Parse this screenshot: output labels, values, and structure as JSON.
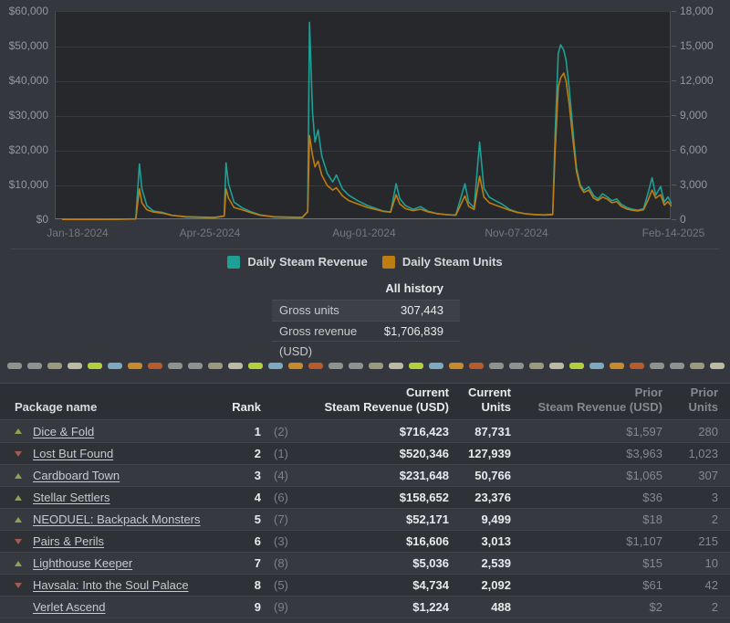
{
  "chart_data": {
    "type": "line",
    "grid": true,
    "legend_position": "bottom",
    "x_ticklabels": [
      "Jan-18-2024",
      "Apr-25-2024",
      "Aug-01-2024",
      "Nov-07-2024",
      "Feb-14-2025"
    ],
    "y_left": {
      "range": [
        0,
        60000
      ],
      "ticklabels": [
        "$60,000",
        "$50,000",
        "$40,000",
        "$30,000",
        "$20,000",
        "$10,000",
        "$0"
      ]
    },
    "y_right": {
      "range": [
        0,
        18000
      ],
      "ticklabels": [
        "18,000",
        "15,000",
        "12,000",
        "9,000",
        "6,000",
        "3,000",
        "0"
      ]
    },
    "x_frac": [
      0,
      0.02,
      0.05,
      0.096,
      0.121,
      0.127,
      0.131,
      0.139,
      0.15,
      0.165,
      0.18,
      0.203,
      0.226,
      0.249,
      0.266,
      0.269,
      0.273,
      0.282,
      0.295,
      0.31,
      0.325,
      0.348,
      0.371,
      0.394,
      0.403,
      0.406,
      0.411,
      0.415,
      0.42,
      0.426,
      0.435,
      0.444,
      0.45,
      0.46,
      0.47,
      0.485,
      0.501,
      0.516,
      0.527,
      0.539,
      0.548,
      0.554,
      0.563,
      0.576,
      0.588,
      0.6,
      0.615,
      0.631,
      0.646,
      0.661,
      0.667,
      0.676,
      0.685,
      0.692,
      0.701,
      0.711,
      0.722,
      0.734,
      0.747,
      0.76,
      0.776,
      0.791,
      0.805,
      0.809,
      0.814,
      0.818,
      0.823,
      0.827,
      0.832,
      0.838,
      0.844,
      0.85,
      0.856,
      0.864,
      0.872,
      0.879,
      0.887,
      0.895,
      0.902,
      0.91,
      0.917,
      0.927,
      0.936,
      0.945,
      0.954,
      0.962,
      0.968,
      0.974,
      0.982,
      0.988,
      0.994,
      1.0
    ],
    "series": [
      {
        "name": "Daily Steam Revenue",
        "axis": "left",
        "color": "#1fa096",
        "values": [
          150,
          200,
          250,
          300,
          400,
          16200,
          9000,
          4200,
          2600,
          2200,
          1400,
          900,
          800,
          700,
          1200,
          16500,
          10500,
          5200,
          3600,
          2400,
          1500,
          900,
          800,
          750,
          2500,
          57000,
          31000,
          22500,
          26000,
          18500,
          13500,
          11000,
          13000,
          9000,
          7200,
          5600,
          4200,
          3300,
          2600,
          2300,
          10500,
          6200,
          4200,
          3100,
          3900,
          2600,
          1900,
          1600,
          1450,
          10500,
          5200,
          3600,
          22500,
          9200,
          6600,
          5600,
          4600,
          3100,
          2300,
          1850,
          1550,
          1450,
          1550,
          25000,
          48000,
          50500,
          49000,
          46000,
          38000,
          26000,
          15000,
          10200,
          8600,
          9600,
          7100,
          6100,
          7600,
          6600,
          5600,
          6100,
          4600,
          3600,
          3100,
          2900,
          3300,
          8200,
          12200,
          7200,
          9700,
          5200,
          6700,
          4700
        ]
      },
      {
        "name": "Daily Steam Units",
        "axis": "right",
        "color": "#bf7d11",
        "values": [
          40,
          50,
          60,
          80,
          100,
          2700,
          1500,
          900,
          700,
          600,
          420,
          300,
          260,
          230,
          350,
          2700,
          1900,
          1100,
          900,
          650,
          430,
          290,
          260,
          240,
          700,
          7300,
          5600,
          4600,
          5100,
          3900,
          3000,
          2600,
          2800,
          2100,
          1700,
          1400,
          1100,
          900,
          760,
          700,
          2200,
          1400,
          1000,
          820,
          950,
          720,
          560,
          470,
          430,
          2100,
          1200,
          920,
          3800,
          2000,
          1500,
          1300,
          1100,
          860,
          660,
          560,
          490,
          460,
          510,
          6000,
          11500,
          12300,
          12700,
          12000,
          10000,
          7000,
          4200,
          2900,
          2400,
          2600,
          1900,
          1700,
          2000,
          1800,
          1500,
          1600,
          1200,
          950,
          850,
          800,
          900,
          1800,
          2600,
          1900,
          2200,
          1300,
          1600,
          1200
        ]
      }
    ]
  },
  "summary": {
    "column_header": "All history",
    "rows": [
      {
        "label": "Gross units",
        "value": "307,443"
      },
      {
        "label": "Gross revenue (USD)",
        "value": "$1,706,839"
      }
    ]
  },
  "separator_colors": [
    "#8e938e",
    "#8e938e",
    "#9b997e",
    "#bcbaa0",
    "#b5cf3a",
    "#7fa9c2",
    "#c88a2d",
    "#b65c2c"
  ],
  "separator_dash_count": 36,
  "table": {
    "headers": {
      "package": "Package name",
      "rank": "Rank",
      "current_revenue": [
        "Current",
        "Steam Revenue (USD)"
      ],
      "current_units": [
        "Current",
        "Units"
      ],
      "prior_revenue": [
        "Prior",
        "Steam Revenue (USD)"
      ],
      "prior_units": [
        "Prior",
        "Units"
      ]
    },
    "rows": [
      {
        "trend": "up",
        "name": "Dice & Fold",
        "rank": "1",
        "prior_rank": "(2)",
        "cur_rev": "$716,423",
        "cur_units": "87,731",
        "prior_rev": "$1,597",
        "prior_units": "280"
      },
      {
        "trend": "down",
        "name": "Lost But Found",
        "rank": "2",
        "prior_rank": "(1)",
        "cur_rev": "$520,346",
        "cur_units": "127,939",
        "prior_rev": "$3,963",
        "prior_units": "1,023"
      },
      {
        "trend": "up",
        "name": "Cardboard Town",
        "rank": "3",
        "prior_rank": "(4)",
        "cur_rev": "$231,648",
        "cur_units": "50,766",
        "prior_rev": "$1,065",
        "prior_units": "307"
      },
      {
        "trend": "up",
        "name": "Stellar Settlers",
        "rank": "4",
        "prior_rank": "(6)",
        "cur_rev": "$158,652",
        "cur_units": "23,376",
        "prior_rev": "$36",
        "prior_units": "3"
      },
      {
        "trend": "up",
        "name": "NEODUEL: Backpack Monsters",
        "rank": "5",
        "prior_rank": "(7)",
        "cur_rev": "$52,171",
        "cur_units": "9,499",
        "prior_rev": "$18",
        "prior_units": "2"
      },
      {
        "trend": "down",
        "name": "Pairs & Perils",
        "rank": "6",
        "prior_rank": "(3)",
        "cur_rev": "$16,606",
        "cur_units": "3,013",
        "prior_rev": "$1,107",
        "prior_units": "215"
      },
      {
        "trend": "up",
        "name": "Lighthouse Keeper",
        "rank": "7",
        "prior_rank": "(8)",
        "cur_rev": "$5,036",
        "cur_units": "2,539",
        "prior_rev": "$15",
        "prior_units": "10"
      },
      {
        "trend": "down",
        "name": "Havsala: Into the Soul Palace",
        "rank": "8",
        "prior_rank": "(5)",
        "cur_rev": "$4,734",
        "cur_units": "2,092",
        "prior_rev": "$61",
        "prior_units": "42"
      },
      {
        "trend": "none",
        "name": "Verlet Ascend",
        "rank": "9",
        "prior_rank": "(9)",
        "cur_rev": "$1,224",
        "cur_units": "488",
        "prior_rev": "$2",
        "prior_units": "2"
      }
    ]
  }
}
